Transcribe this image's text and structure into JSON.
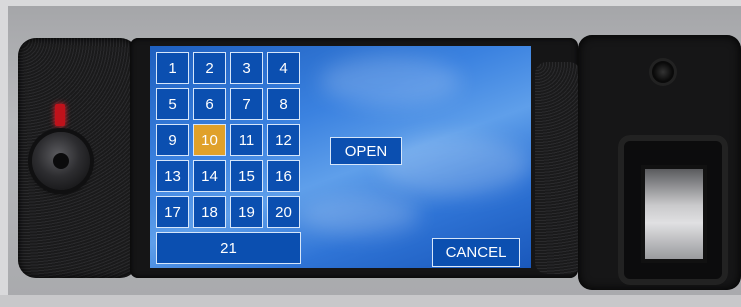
{
  "keypad": {
    "keys": [
      {
        "label": "1",
        "selected": false
      },
      {
        "label": "2",
        "selected": false
      },
      {
        "label": "3",
        "selected": false
      },
      {
        "label": "4",
        "selected": false
      },
      {
        "label": "5",
        "selected": false
      },
      {
        "label": "6",
        "selected": false
      },
      {
        "label": "7",
        "selected": false
      },
      {
        "label": "8",
        "selected": false
      },
      {
        "label": "9",
        "selected": false
      },
      {
        "label": "10",
        "selected": true
      },
      {
        "label": "11",
        "selected": false
      },
      {
        "label": "12",
        "selected": false
      },
      {
        "label": "13",
        "selected": false
      },
      {
        "label": "14",
        "selected": false
      },
      {
        "label": "15",
        "selected": false
      },
      {
        "label": "16",
        "selected": false
      },
      {
        "label": "17",
        "selected": false
      },
      {
        "label": "18",
        "selected": false
      },
      {
        "label": "19",
        "selected": false
      },
      {
        "label": "20",
        "selected": false
      },
      {
        "label": "21",
        "selected": false
      }
    ]
  },
  "actions": {
    "open_label": "OPEN",
    "cancel_label": "CANCEL"
  },
  "colors": {
    "key_bg": "#0b4fb0",
    "key_selected_bg": "#e0a12a",
    "led": "#c0121b"
  }
}
